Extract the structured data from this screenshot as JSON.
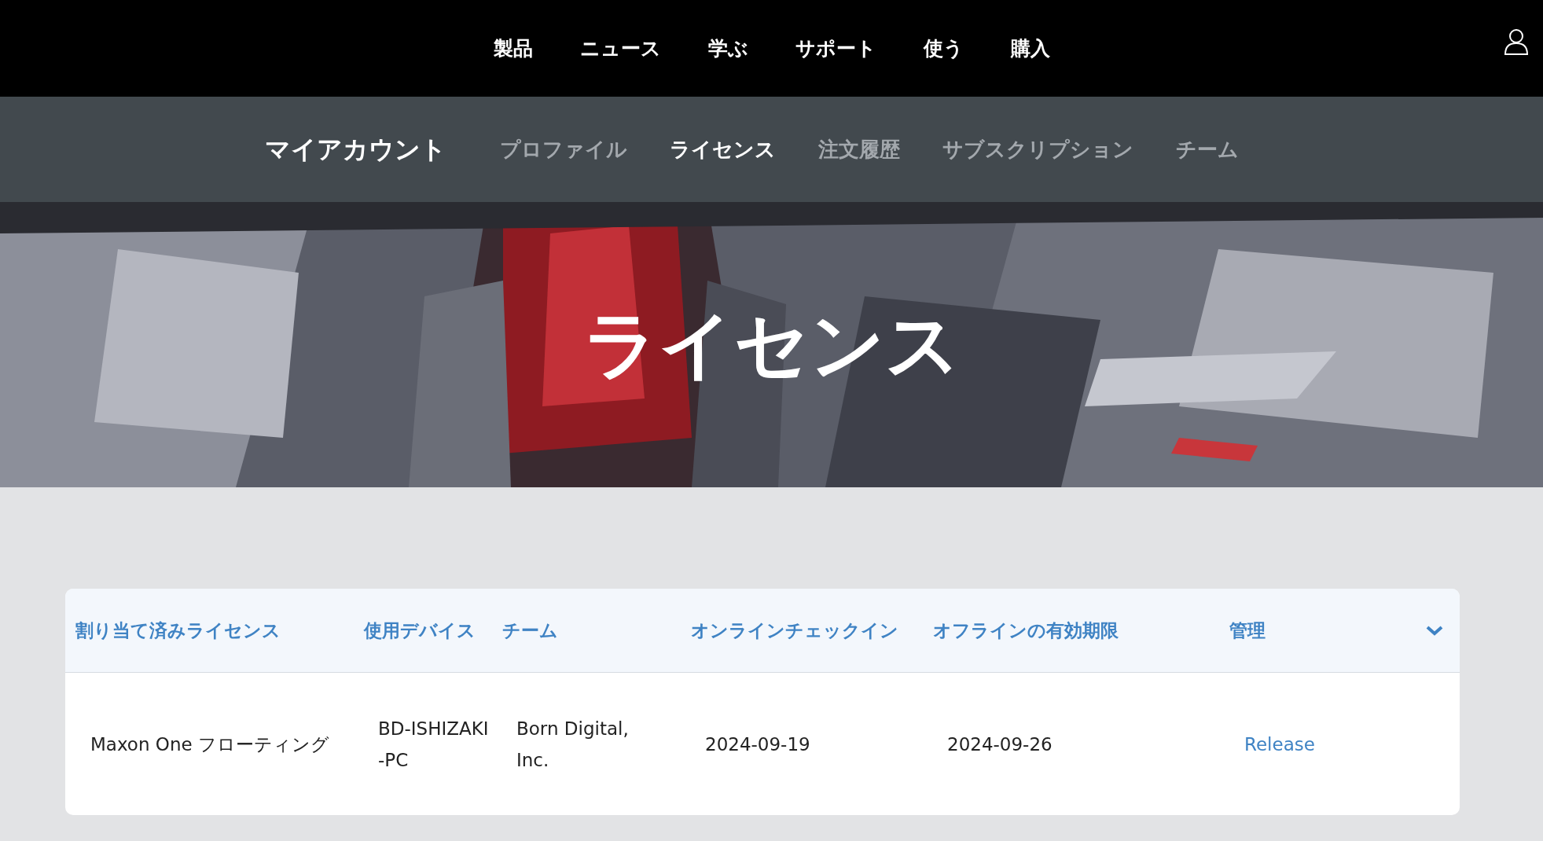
{
  "top_nav": {
    "items": [
      "製品",
      "ニュース",
      "学ぶ",
      "サポート",
      "使う",
      "購入"
    ]
  },
  "account_nav": {
    "title": "マイアカウント",
    "tabs": [
      {
        "label": "プロファイル",
        "selected": false
      },
      {
        "label": "ライセンス",
        "selected": true
      },
      {
        "label": "注文履歴",
        "selected": false
      },
      {
        "label": "サブスクリプション",
        "selected": false
      },
      {
        "label": "チーム",
        "selected": false
      }
    ]
  },
  "hero": {
    "title": "ライセンス",
    "kind": "picture"
  },
  "table": {
    "columns": [
      "割り当て済みライセンス",
      "使用デバイス",
      "チーム",
      "オンラインチェックイン",
      "オフラインの有効期限",
      "管理"
    ],
    "expanded": true,
    "rows": [
      {
        "license": "Maxon One フローティング",
        "device": "BD-ISHIZAKI-PC",
        "team": "Born Digital, Inc.",
        "online_checkin": "2024-09-19",
        "offline_expiry": "2024-09-26",
        "action": "Release"
      }
    ]
  }
}
